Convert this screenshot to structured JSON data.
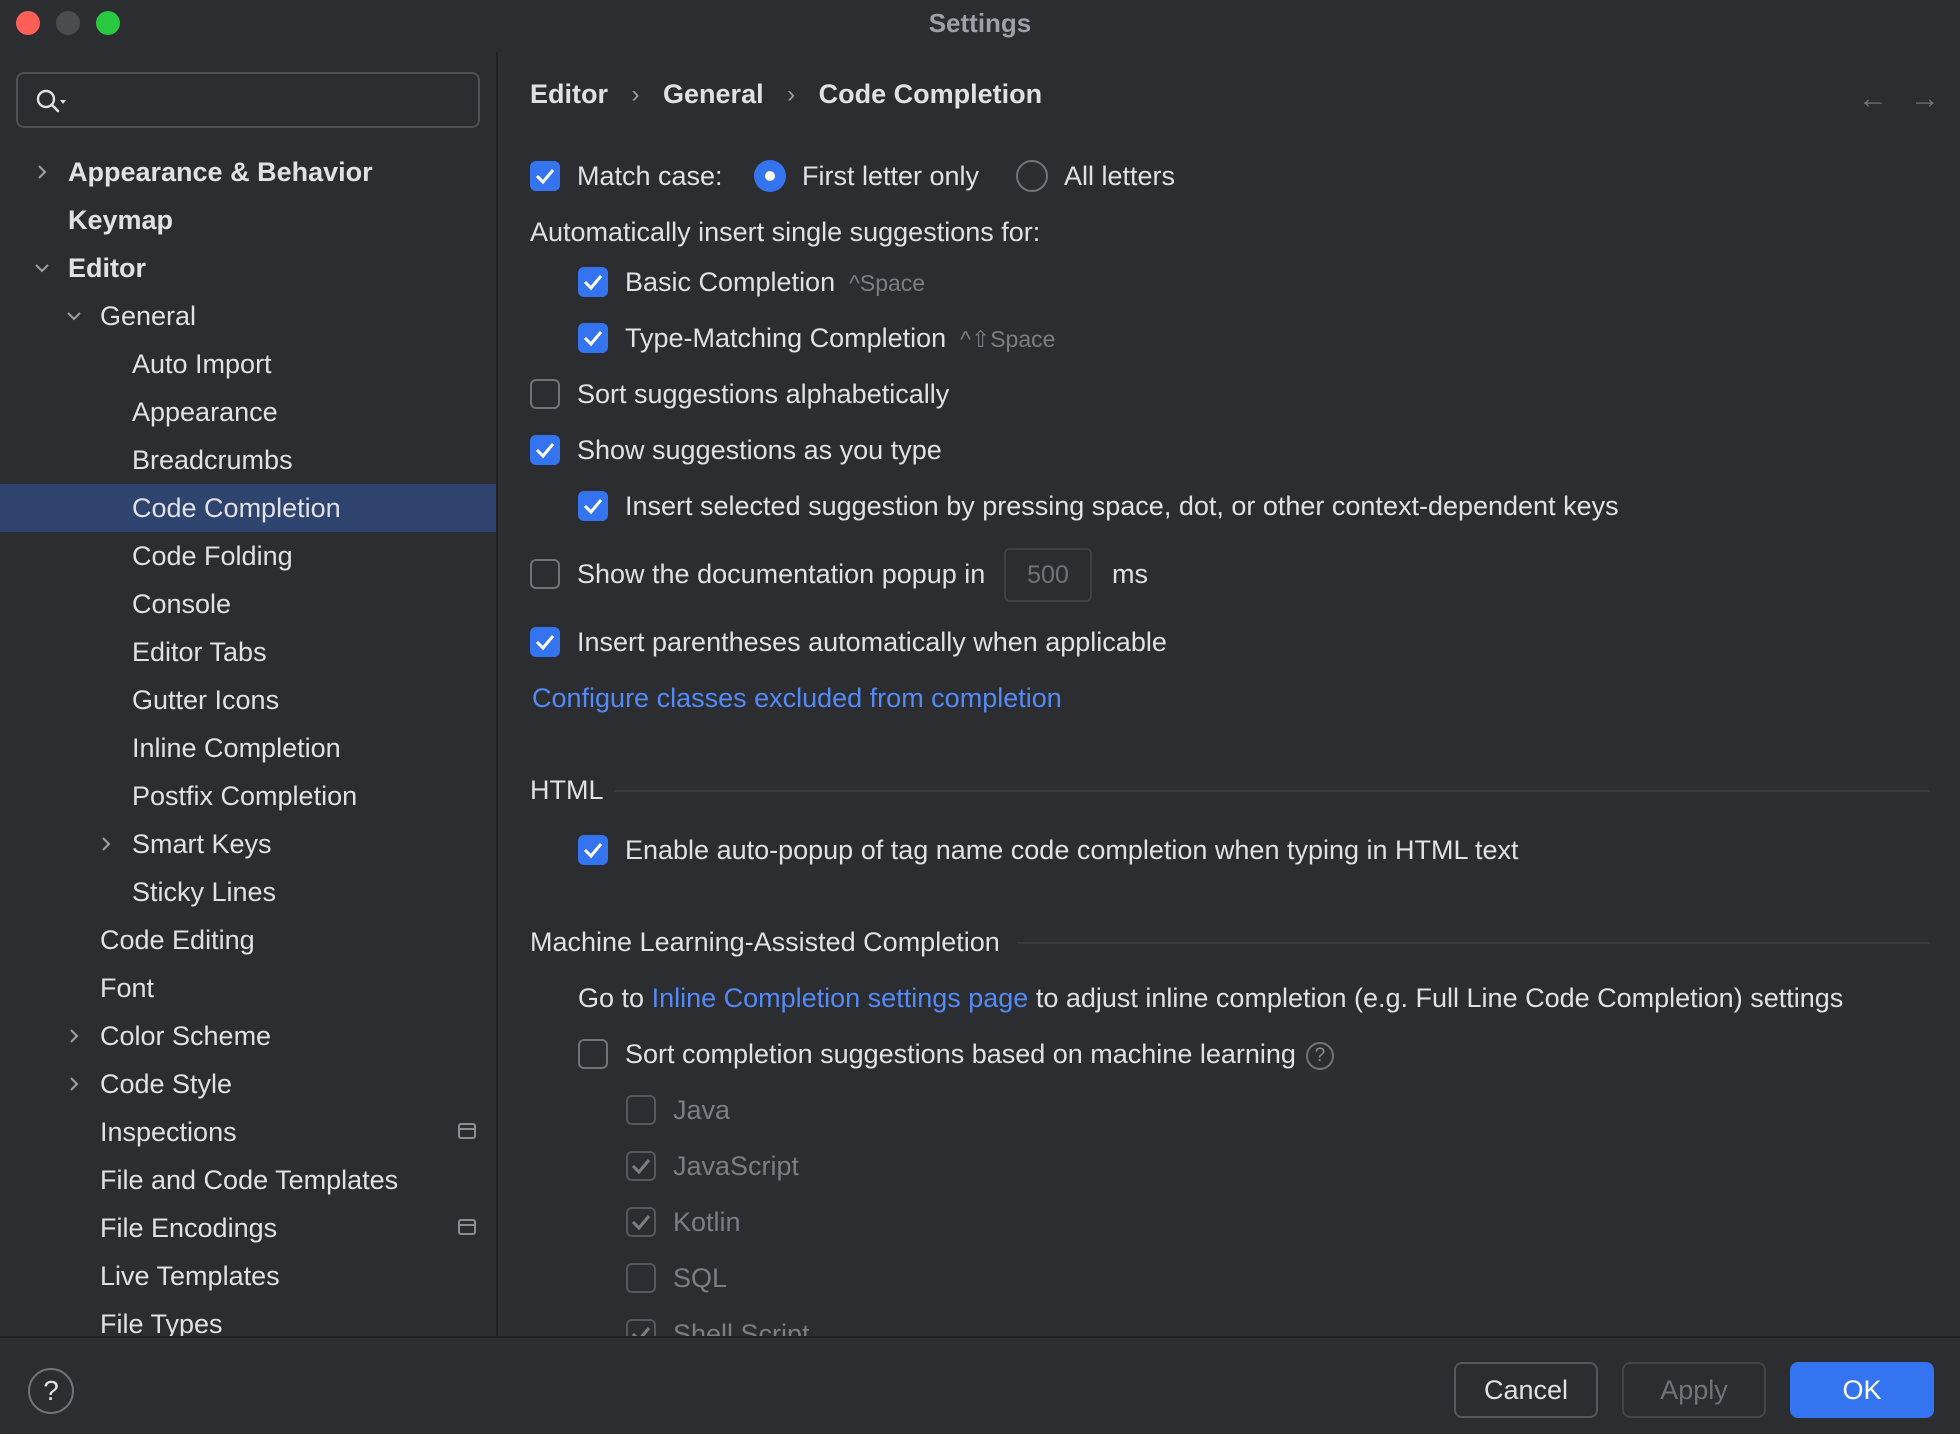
{
  "window": {
    "title": "Settings"
  },
  "sidebar": {
    "items": [
      {
        "label": "Appearance & Behavior",
        "chevron": "right"
      },
      {
        "label": "Keymap"
      },
      {
        "label": "Editor",
        "chevron": "down"
      },
      {
        "label": "General",
        "chevron": "down"
      },
      {
        "label": "Auto Import"
      },
      {
        "label": "Appearance"
      },
      {
        "label": "Breadcrumbs"
      },
      {
        "label": "Code Completion",
        "selected": true
      },
      {
        "label": "Code Folding"
      },
      {
        "label": "Console"
      },
      {
        "label": "Editor Tabs"
      },
      {
        "label": "Gutter Icons"
      },
      {
        "label": "Inline Completion"
      },
      {
        "label": "Postfix Completion"
      },
      {
        "label": "Smart Keys",
        "chevron": "right"
      },
      {
        "label": "Sticky Lines"
      },
      {
        "label": "Code Editing"
      },
      {
        "label": "Font"
      },
      {
        "label": "Color Scheme",
        "chevron": "right"
      },
      {
        "label": "Code Style",
        "chevron": "right"
      },
      {
        "label": "Inspections",
        "badge": "project-settings-icon"
      },
      {
        "label": "File and Code Templates"
      },
      {
        "label": "File Encodings",
        "badge": "project-settings-icon"
      },
      {
        "label": "Live Templates"
      },
      {
        "label": "File Types"
      }
    ]
  },
  "breadcrumb": {
    "items": [
      "Editor",
      "General",
      "Code Completion"
    ],
    "separator": "›"
  },
  "nav": {
    "back": "←",
    "forward": "→"
  },
  "options": {
    "match_case": "Match case:",
    "first_letter_only": "First letter only",
    "all_letters": "All letters",
    "auto_insert_heading": "Automatically insert single suggestions for:",
    "basic_completion": "Basic Completion",
    "basic_shortcut": "^Space",
    "type_matching": "Type-Matching Completion",
    "type_matching_shortcut": "^⇧Space",
    "sort_alpha": "Sort suggestions alphabetically",
    "show_as_type": "Show suggestions as you type",
    "insert_selected": "Insert selected suggestion by pressing space, dot, or other context-dependent keys",
    "doc_popup": "Show the documentation popup in",
    "doc_popup_value": "500",
    "doc_popup_unit": "ms",
    "insert_parens": "Insert parentheses automatically when applicable",
    "configure_link": "Configure classes excluded from completion"
  },
  "html_section": {
    "title": "HTML",
    "auto_popup": "Enable auto-popup of tag name code completion when typing in HTML text"
  },
  "ml_section": {
    "title": "Machine Learning-Assisted Completion",
    "goto_prefix": "Go to",
    "goto_link": "Inline Completion settings page",
    "goto_suffix": "to adjust inline completion (e.g. Full Line Code Completion) settings",
    "sort_ml": "Sort completion suggestions based on machine learning",
    "languages": [
      {
        "label": "Java",
        "checked": false
      },
      {
        "label": "JavaScript",
        "checked": true
      },
      {
        "label": "Kotlin",
        "checked": true
      },
      {
        "label": "SQL",
        "checked": false
      },
      {
        "label": "Shell Script",
        "checked": true
      }
    ]
  },
  "footer": {
    "help": "?",
    "cancel": "Cancel",
    "apply": "Apply",
    "ok": "OK"
  },
  "colors": {
    "accent": "#3574f0",
    "link": "#548af7",
    "selection": "#2e436e",
    "background": "#2b2d30"
  }
}
